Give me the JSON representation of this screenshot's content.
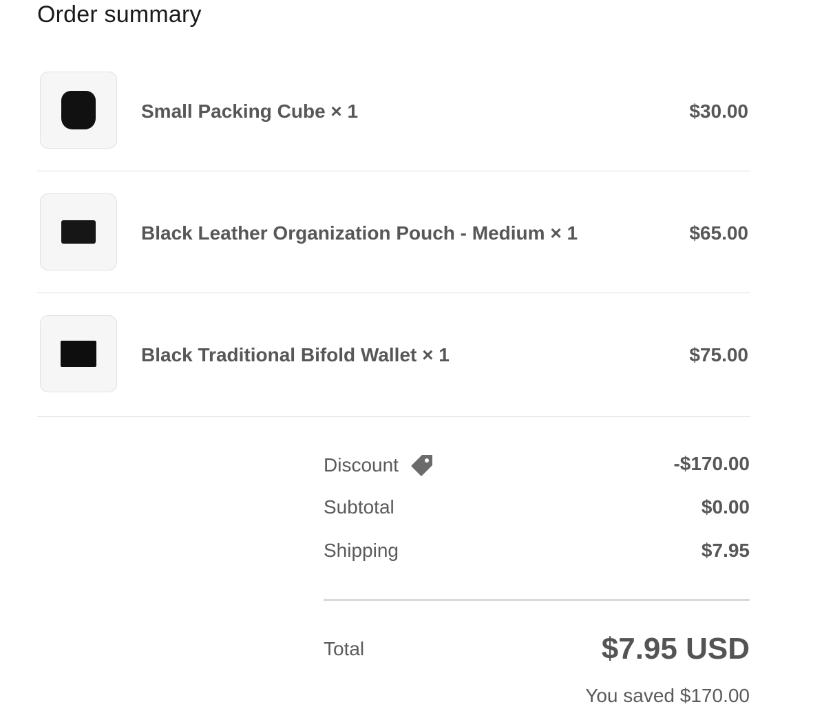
{
  "title": "Order summary",
  "items": [
    {
      "name": "Small Packing Cube × 1",
      "price": "$30.00",
      "thumbnail": "packing-cube"
    },
    {
      "name": "Black Leather Organization Pouch - Medium × 1",
      "price": "$65.00",
      "thumbnail": "leather-pouch"
    },
    {
      "name": "Black Traditional Bifold Wallet × 1",
      "price": "$75.00",
      "thumbnail": "bifold-wallet"
    }
  ],
  "summary": {
    "discount_label": "Discount",
    "discount_icon": "tag-icon",
    "discount_value": "-$170.00",
    "subtotal_label": "Subtotal",
    "subtotal_value": "$0.00",
    "shipping_label": "Shipping",
    "shipping_value": "$7.95",
    "total_label": "Total",
    "total_value": "$7.95 USD",
    "saved_text": "You saved $170.00"
  },
  "colors": {
    "text": "#545454",
    "heading": "#1a1a1a",
    "divider": "#dedede",
    "thumb_bg": "#f6f6f6",
    "tag_icon": "#6b6b6b"
  }
}
